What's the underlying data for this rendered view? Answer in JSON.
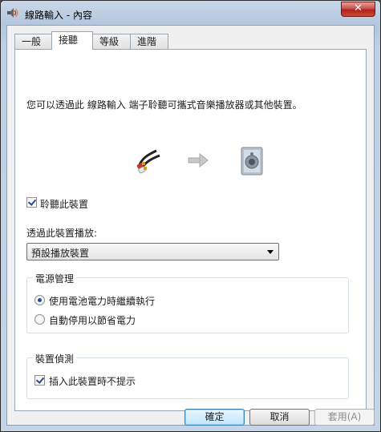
{
  "window": {
    "title": "線路輸入 - 內容",
    "close_label": "✕"
  },
  "tabs": [
    {
      "label": "一般"
    },
    {
      "label": "接聽"
    },
    {
      "label": "等級"
    },
    {
      "label": "進階"
    }
  ],
  "active_tab": "接聽",
  "listen": {
    "description": "您可以透過此 線路輸入 端子聆聽可攜式音樂播放器或其他裝置。",
    "listen_checkbox": {
      "label": "聆聽此裝置",
      "checked": true
    },
    "playback_label": "透過此裝置播放:",
    "playback_select": {
      "value": "預設播放裝置"
    }
  },
  "power": {
    "title": "電源管理",
    "options": [
      {
        "label": "使用電池電力時繼續執行",
        "selected": true
      },
      {
        "label": "自動停用以節省電力",
        "selected": false
      }
    ]
  },
  "detection": {
    "title": "裝置偵測",
    "checkbox": {
      "label": "插入此裝置時不提示",
      "checked": true
    }
  },
  "buttons": {
    "ok": "確定",
    "cancel": "取消",
    "apply": "套用(A)"
  },
  "icons": {
    "title": "speaker-volume-icon",
    "cable": "audio-cable-icon",
    "arrow": "arrow-right-icon",
    "device": "speaker-device-icon"
  }
}
